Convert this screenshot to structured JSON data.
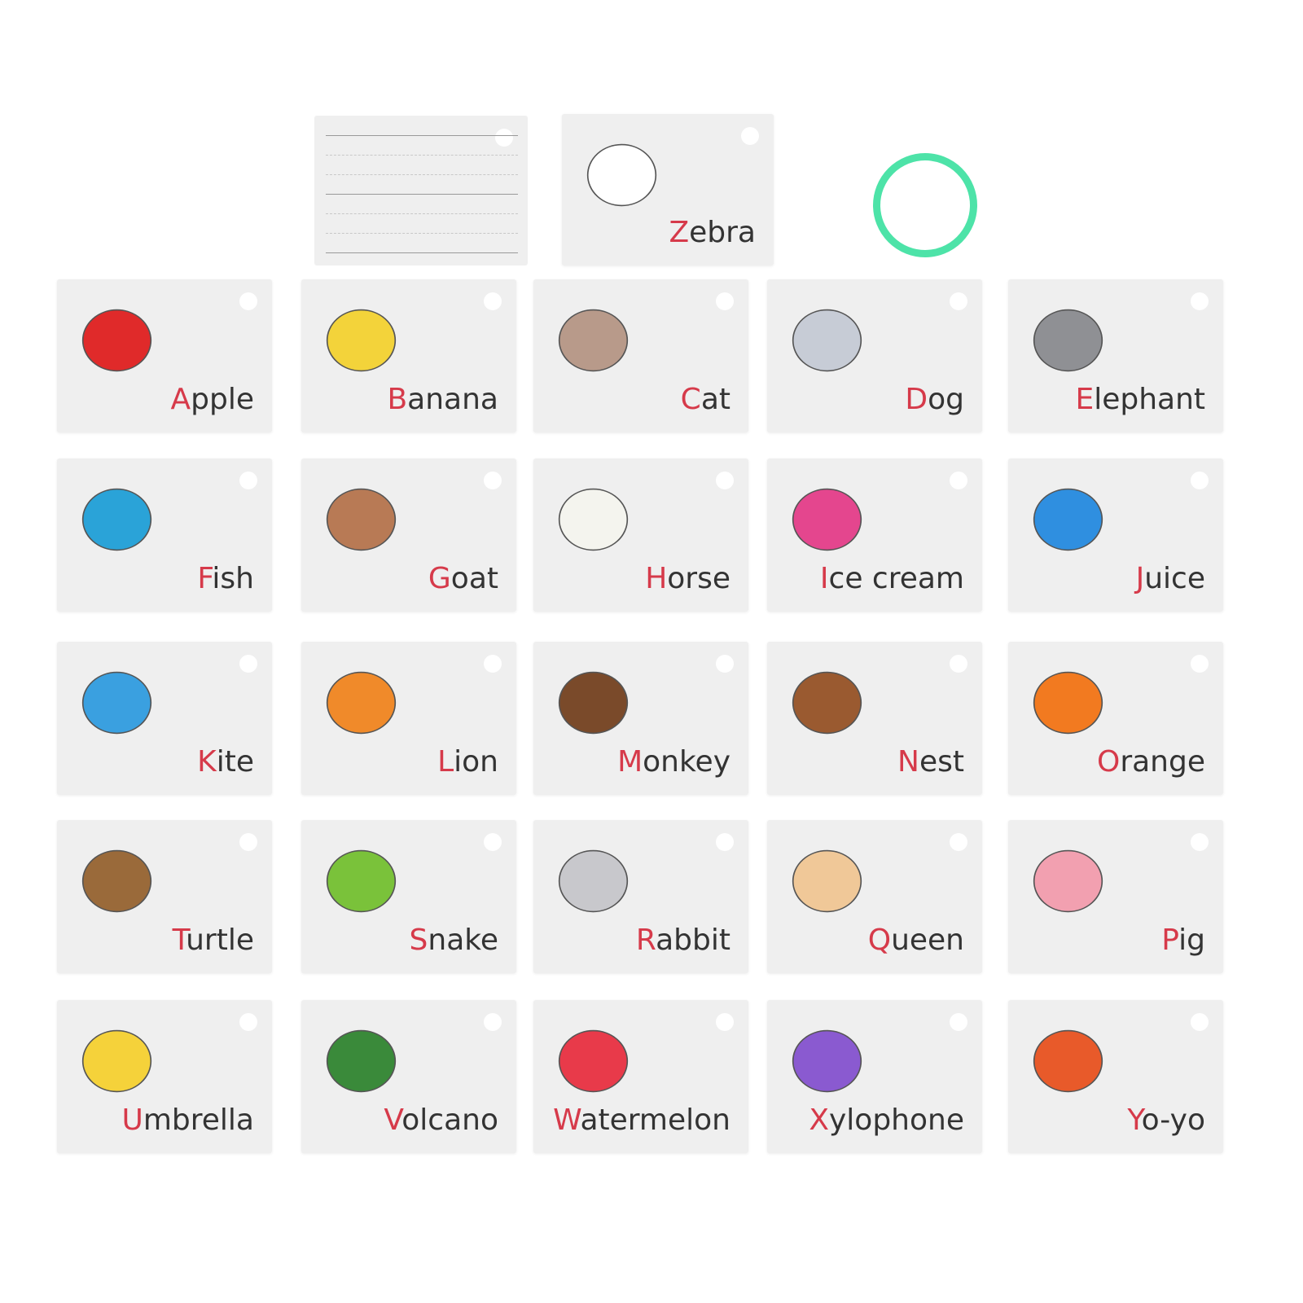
{
  "accent_color": "#d63a4a",
  "text_color": "#333333",
  "ring_color": "#4de3a8",
  "top_card": {
    "word": "Zebra",
    "icon": "zebra",
    "color": "#ffffff"
  },
  "cards": [
    {
      "word": "Apple",
      "icon": "apple",
      "color": "#e02a2a"
    },
    {
      "word": "Banana",
      "icon": "banana",
      "color": "#f3d33a"
    },
    {
      "word": "Cat",
      "icon": "cat",
      "color": "#b89a8a"
    },
    {
      "word": "Dog",
      "icon": "dog",
      "color": "#c7ccd6"
    },
    {
      "word": "Elephant",
      "icon": "elephant",
      "color": "#8f9094"
    },
    {
      "word": "Fish",
      "icon": "fish",
      "color": "#2aa3d8"
    },
    {
      "word": "Goat",
      "icon": "goat",
      "color": "#b87a55"
    },
    {
      "word": "Horse",
      "icon": "horse",
      "color": "#f4f4ee"
    },
    {
      "word": "Ice cream",
      "icon": "ice-cream",
      "color": "#e4468e"
    },
    {
      "word": "Juice",
      "icon": "juice-box",
      "color": "#2f8fe0"
    },
    {
      "word": "Kite",
      "icon": "kite",
      "color": "#3aa0e0"
    },
    {
      "word": "Lion",
      "icon": "lion",
      "color": "#f08a2a"
    },
    {
      "word": "Monkey",
      "icon": "monkey",
      "color": "#7a4a2a"
    },
    {
      "word": "Nest",
      "icon": "nest",
      "color": "#9a5a30"
    },
    {
      "word": "Orange",
      "icon": "orange",
      "color": "#f27a20"
    },
    {
      "word": "Turtle",
      "icon": "turtle",
      "color": "#9a6a3a"
    },
    {
      "word": "Snake",
      "icon": "snake",
      "color": "#7ac23a"
    },
    {
      "word": "Rabbit",
      "icon": "rabbit",
      "color": "#c8c8cc"
    },
    {
      "word": "Queen",
      "icon": "queen",
      "color": "#f0c898"
    },
    {
      "word": "Pig",
      "icon": "pig",
      "color": "#f2a0b0"
    },
    {
      "word": "Umbrella",
      "icon": "umbrella",
      "color": "#f5d23a"
    },
    {
      "word": "Volcano",
      "icon": "volcano",
      "color": "#3a8a3a"
    },
    {
      "word": "Watermelon",
      "icon": "watermelon",
      "color": "#e83a4a"
    },
    {
      "word": "Xylophone",
      "icon": "xylophone",
      "color": "#8a5ad0"
    },
    {
      "word": "Yo-yo",
      "icon": "yo-yo",
      "color": "#e85a2a"
    }
  ]
}
